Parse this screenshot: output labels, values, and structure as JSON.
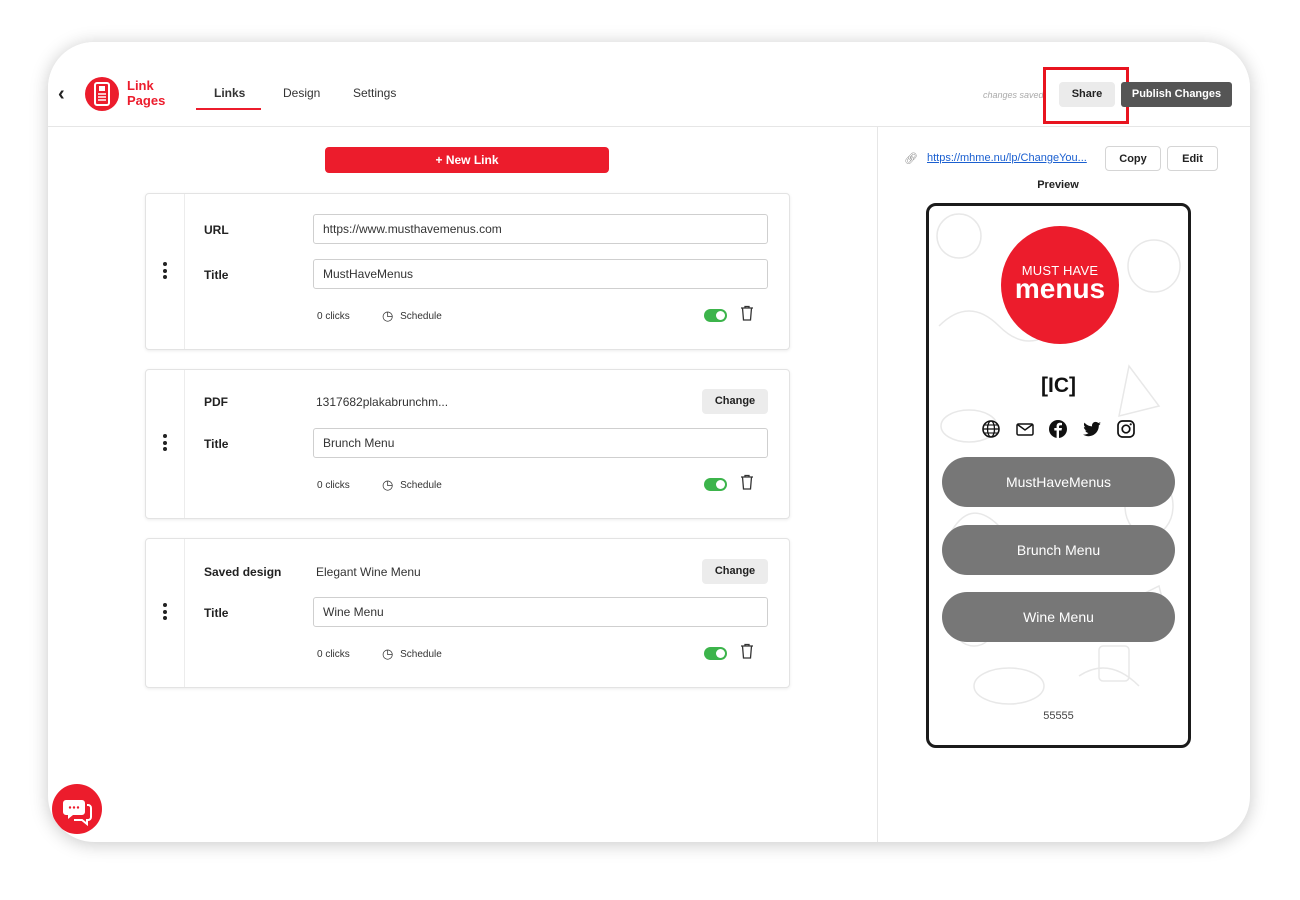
{
  "app": {
    "back_icon": "chevron-left-icon",
    "logo_icon": "menu-phone-icon",
    "logo_line1": "Link",
    "logo_line2": "Pages"
  },
  "tabs": [
    {
      "label": "Links",
      "active": true
    },
    {
      "label": "Design",
      "active": false
    },
    {
      "label": "Settings",
      "active": false
    }
  ],
  "header": {
    "status_text": "changes saved",
    "share_label": "Share",
    "publish_label": "Publish Changes"
  },
  "links": {
    "new_link_label": "+ New Link",
    "title_label": "Title",
    "schedule_label": "Schedule",
    "change_label": "Change",
    "items": [
      {
        "type_label": "URL",
        "value": "https://www.musthavemenus.com",
        "title": "MustHaveMenus",
        "clicks": "0 clicks",
        "enabled": true
      },
      {
        "type_label": "PDF",
        "value": "1317682plakabrunchm...",
        "title": "Brunch Menu",
        "clicks": "0 clicks",
        "enabled": true
      },
      {
        "type_label": "Saved design",
        "value": "Elegant Wine Menu",
        "title": "Wine Menu",
        "clicks": "0 clicks",
        "enabled": true
      }
    ]
  },
  "preview": {
    "url": "https://mhme.nu/lp/ChangeYou...",
    "copy_label": "Copy",
    "edit_label": "Edit",
    "heading": "Preview",
    "brand_line1": "MUST HAVE",
    "brand_line2": "menus",
    "name": "[IC]",
    "social_icons": [
      "globe-icon",
      "mail-icon",
      "facebook-icon",
      "twitter-icon",
      "instagram-icon"
    ],
    "buttons": [
      "MustHaveMenus",
      "Brunch Menu",
      "Wine Menu"
    ],
    "footer": "55555"
  },
  "colors": {
    "brand_red": "#ec1c2c",
    "toggle_on": "#3cb44b",
    "publish_bg": "#555555",
    "pill_bg": "#777777"
  }
}
